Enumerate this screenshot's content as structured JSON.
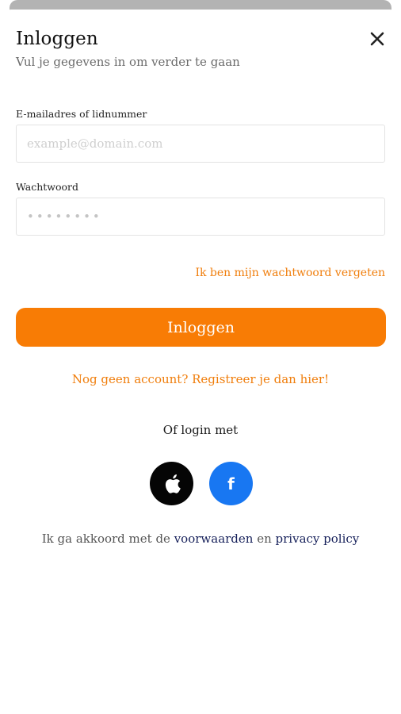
{
  "header": {
    "title": "Inloggen",
    "subtitle": "Vul je gegevens in om verder te gaan",
    "close_icon": "close-icon"
  },
  "form": {
    "email_label": "E-mailadres of lidnummer",
    "email_placeholder": "example@domain.com",
    "email_value": "",
    "password_label": "Wachtwoord",
    "password_placeholder": "••••••••",
    "password_value": "",
    "forgot_link": "Ik ben mijn wachtwoord vergeten",
    "submit_label": "Inloggen"
  },
  "register_link": "Nog geen account? Registreer je dan hier!",
  "social": {
    "heading": "Of login met",
    "apple_icon": "apple-icon",
    "facebook_icon": "facebook-icon"
  },
  "terms": {
    "prefix": "Ik ga akkoord met de ",
    "terms_link": "voorwaarden",
    "connector": " en ",
    "privacy_link": "privacy policy"
  },
  "colors": {
    "accent": "#f87c05",
    "link_orange": "#f07e0c",
    "facebook_blue": "#1877f2",
    "legal_link": "#16205a"
  }
}
